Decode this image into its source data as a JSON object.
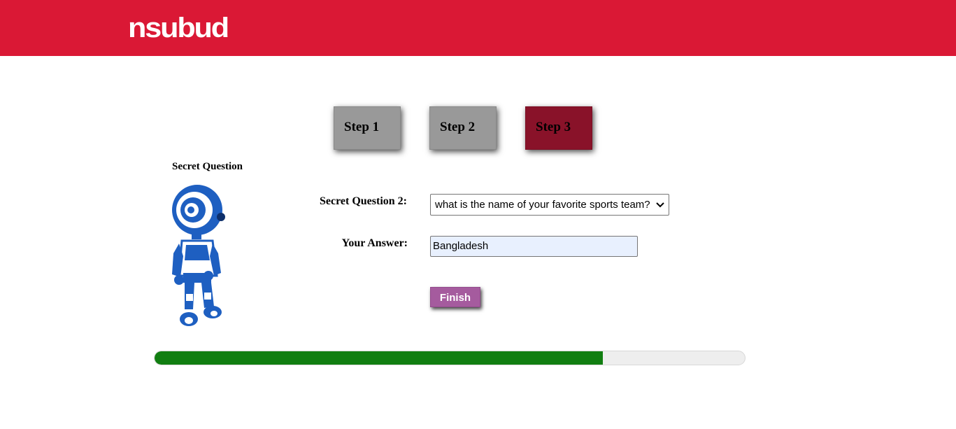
{
  "header": {
    "logo_text": "nsubud",
    "color": "#da1835"
  },
  "steps": [
    {
      "label": "Step 1",
      "state": "inactive"
    },
    {
      "label": "Step 2",
      "state": "inactive"
    },
    {
      "label": "Step 3",
      "state": "active"
    }
  ],
  "side": {
    "title": "Secret Question",
    "image": "robot-mascot"
  },
  "form": {
    "question_label": "Secret Question 2:",
    "question_selected": "what is the name of your favorite sports team?",
    "answer_label": "Your Answer:",
    "answer_value": "Bangladesh",
    "finish_label": "Finish"
  },
  "progress": {
    "fraction": 0.76,
    "color": "#117e11"
  }
}
